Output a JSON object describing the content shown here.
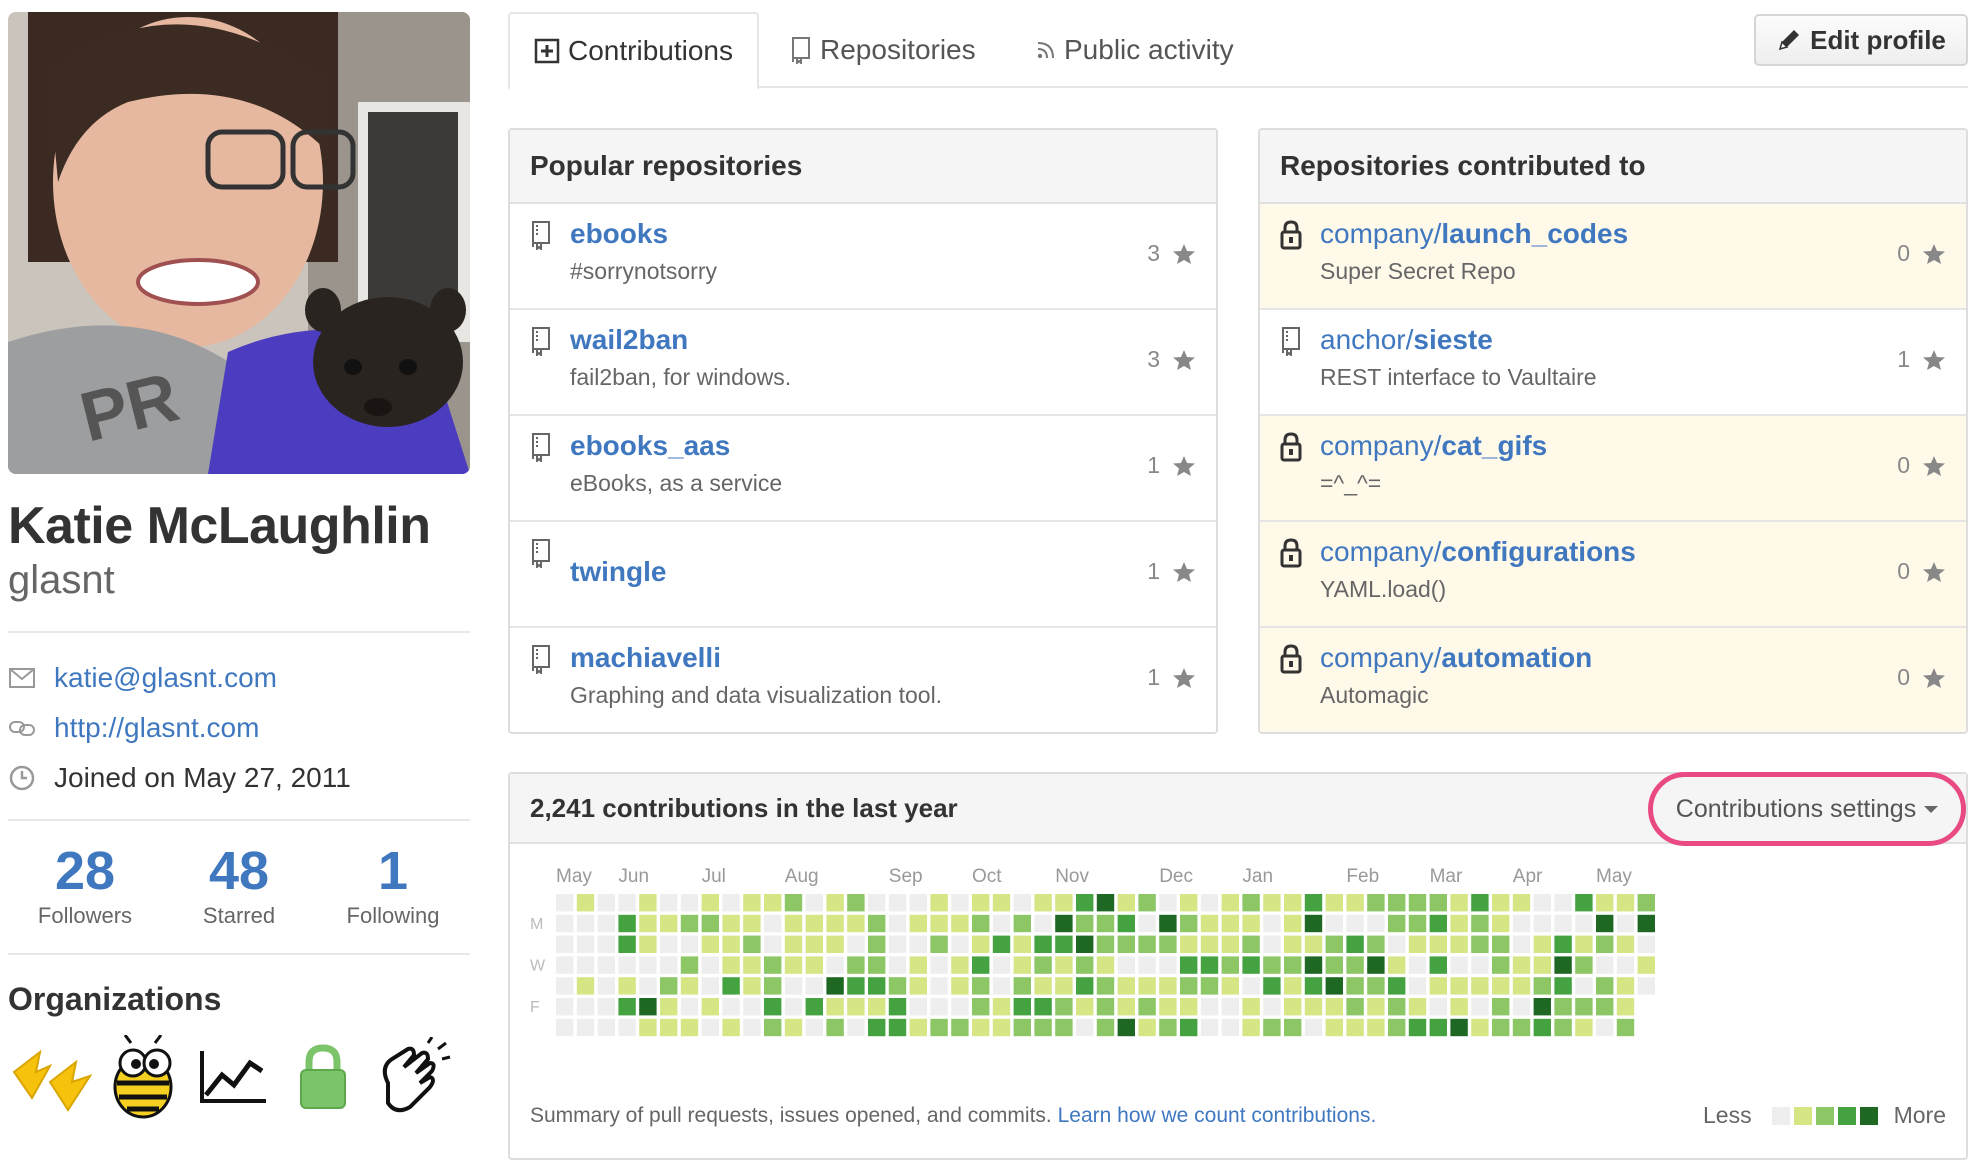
{
  "profile": {
    "full_name": "Katie McLaughlin",
    "username": "glasnt",
    "email": "katie@glasnt.com",
    "website": "http://glasnt.com",
    "joined": "Joined on May 27, 2011",
    "stats": [
      {
        "value": "28",
        "label": "Followers"
      },
      {
        "value": "48",
        "label": "Starred"
      },
      {
        "value": "1",
        "label": "Following"
      }
    ],
    "organizations_title": "Organizations",
    "organizations": [
      "duck-feet-icon",
      "bee-icon",
      "chart-icon",
      "lock-icon",
      "clapping-hands-icon"
    ]
  },
  "tabs": [
    {
      "label": "Contributions",
      "icon": "plus-box-icon",
      "selected": true
    },
    {
      "label": "Repositories",
      "icon": "repo-icon",
      "selected": false
    },
    {
      "label": "Public activity",
      "icon": "rss-icon",
      "selected": false
    }
  ],
  "edit_profile_label": "Edit profile",
  "popular": {
    "title": "Popular repositories",
    "repos": [
      {
        "name": "ebooks",
        "desc": "#sorrynotsorry",
        "stars": "3"
      },
      {
        "name": "wail2ban",
        "desc": "fail2ban, for windows.",
        "stars": "3"
      },
      {
        "name": "ebooks_aas",
        "desc": "eBooks, as a service",
        "stars": "1"
      },
      {
        "name": "twingle",
        "desc": "",
        "stars": "1"
      },
      {
        "name": "machiavelli",
        "desc": "Graphing and data visualization tool.",
        "stars": "1"
      }
    ]
  },
  "contributed": {
    "title": "Repositories contributed to",
    "repos": [
      {
        "owner": "company/",
        "name": "launch_codes",
        "desc": "Super Secret Repo",
        "stars": "0",
        "private": true
      },
      {
        "owner": "anchor/",
        "name": "sieste",
        "desc": "REST interface to Vaultaire",
        "stars": "1",
        "private": false
      },
      {
        "owner": "company/",
        "name": "cat_gifs",
        "desc": "=^_^=",
        "stars": "0",
        "private": true
      },
      {
        "owner": "company/",
        "name": "configurations",
        "desc": "YAML.load()",
        "stars": "0",
        "private": true
      },
      {
        "owner": "company/",
        "name": "automation",
        "desc": "Automagic",
        "stars": "0",
        "private": true
      }
    ]
  },
  "contributions": {
    "title": "2,241 contributions in the last year",
    "settings_label": "Contributions settings",
    "months": [
      "May",
      "Jun",
      "Jul",
      "Aug",
      "Sep",
      "Oct",
      "Nov",
      "Dec",
      "Jan",
      "Feb",
      "Mar",
      "Apr",
      "May"
    ],
    "day_labels": [
      "M",
      "W",
      "F"
    ],
    "summary_text": "Summary of pull requests, issues opened, and commits.",
    "summary_link": "Learn how we count contributions.",
    "legend_less": "Less",
    "legend_more": "More",
    "colors": [
      "#eeeeee",
      "#d6e685",
      "#8cc665",
      "#44a340",
      "#1e6823"
    ]
  }
}
